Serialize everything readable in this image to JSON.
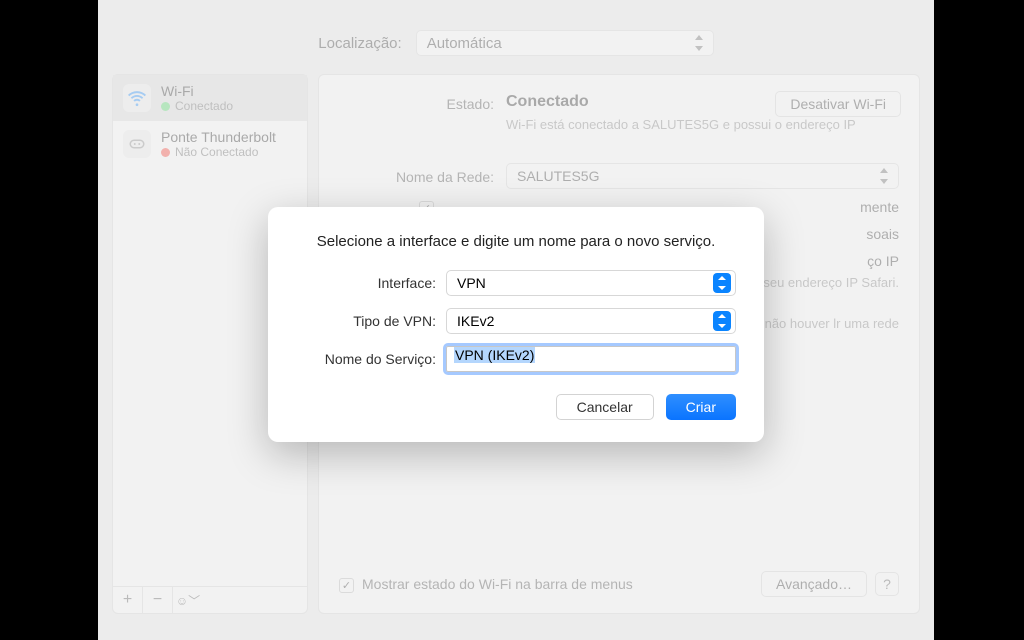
{
  "top": {
    "location_label": "Localização:",
    "location_value": "Automática"
  },
  "sidebar": {
    "wifi": {
      "name": "Wi-Fi",
      "status": "Conectado"
    },
    "tb": {
      "name": "Ponte Thunderbolt",
      "status": "Não Conectado"
    },
    "toolbar": {
      "add": "+",
      "remove": "−",
      "more": "☺︎﹀"
    }
  },
  "detail": {
    "state_label": "Estado:",
    "state_value": "Conectado",
    "deactivate": "Desativar Wi-Fi",
    "conn_desc": "Wi-Fi está conectado a SALUTES5G e possui o endereço IP",
    "net_label": "Nome da Rede:",
    "net_value": "SALUTES5G",
    "auto_join": "mente",
    "ask_personal": "soais",
    "limit_ip": "ço IP",
    "limit_ip_desc": "ocultar seu endereço IP Safari.",
    "ask_new_desc": "mática. Se não houver lr uma rede",
    "menubar": "Mostrar estado do Wi-Fi na barra de menus",
    "advanced": "Avançado…",
    "help": "?"
  },
  "modal": {
    "title": "Selecione a interface e digite um nome para o novo serviço.",
    "interface_label": "Interface:",
    "interface_value": "VPN",
    "type_label": "Tipo de VPN:",
    "type_value": "IKEv2",
    "name_label": "Nome do Serviço:",
    "name_value": "VPN (IKEv2)",
    "cancel": "Cancelar",
    "create": "Criar"
  }
}
